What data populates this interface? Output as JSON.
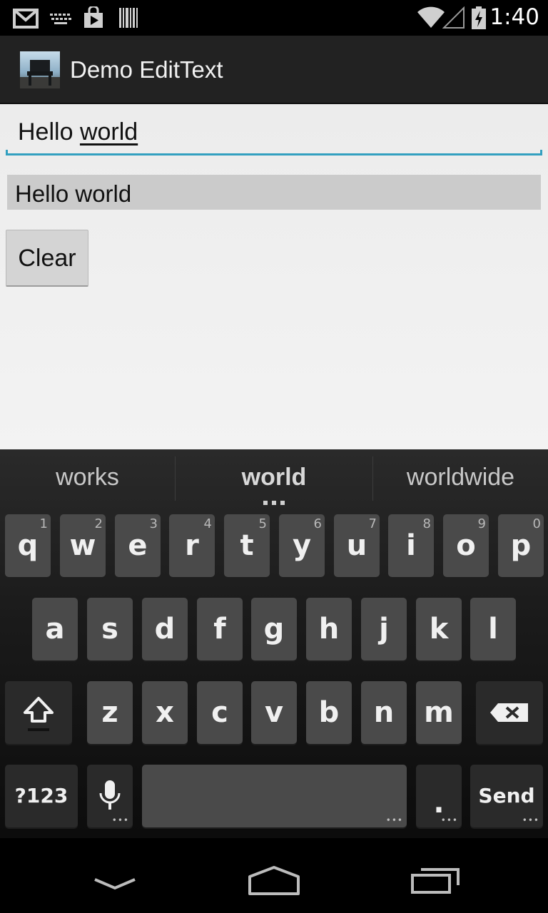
{
  "status_bar": {
    "time": "1:40",
    "icons": [
      "gmail-icon",
      "keyboard-icon",
      "play-store-icon",
      "barcode-icon",
      "wifi-icon",
      "signal-icon",
      "battery-charging-icon"
    ]
  },
  "action_bar": {
    "title": "Demo EditText",
    "icon": "app-launcher-icon"
  },
  "content": {
    "edit_text_value": "Hello world",
    "edit_text_prefix": "Hello ",
    "edit_text_composing": "world",
    "echo_text": "Hello world",
    "clear_button": "Clear"
  },
  "keyboard": {
    "suggestions": [
      "works",
      "world",
      "worldwide"
    ],
    "row1": [
      {
        "label": "q",
        "hint": "1"
      },
      {
        "label": "w",
        "hint": "2"
      },
      {
        "label": "e",
        "hint": "3"
      },
      {
        "label": "r",
        "hint": "4"
      },
      {
        "label": "t",
        "hint": "5"
      },
      {
        "label": "y",
        "hint": "6"
      },
      {
        "label": "u",
        "hint": "7"
      },
      {
        "label": "i",
        "hint": "8"
      },
      {
        "label": "o",
        "hint": "9"
      },
      {
        "label": "p",
        "hint": "0"
      }
    ],
    "row2": [
      "a",
      "s",
      "d",
      "f",
      "g",
      "h",
      "j",
      "k",
      "l"
    ],
    "row3": [
      "z",
      "x",
      "c",
      "v",
      "b",
      "n",
      "m"
    ],
    "symbols_key": "?123",
    "period_key": ".",
    "send_key": "Send"
  },
  "colors": {
    "accent": "#33a0c0",
    "action_bar": "#222222",
    "key": "#4a4a4a"
  }
}
